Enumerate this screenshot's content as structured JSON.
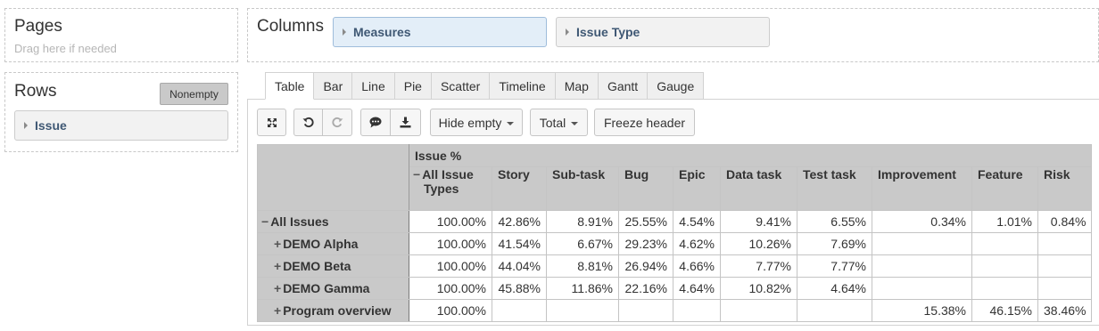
{
  "pages_panel": {
    "title": "Pages",
    "hint": "Drag here if needed"
  },
  "rows_panel": {
    "title": "Rows",
    "nonempty_label": "Nonempty",
    "chip_label": "Issue"
  },
  "columns_panel": {
    "title": "Columns",
    "chips": [
      "Measures",
      "Issue Type"
    ]
  },
  "tabs": [
    "Table",
    "Bar",
    "Line",
    "Pie",
    "Scatter",
    "Timeline",
    "Map",
    "Gantt",
    "Gauge"
  ],
  "active_tab": "Table",
  "toolbar": {
    "hide_empty_label": "Hide empty",
    "total_label": "Total",
    "freeze_label": "Freeze header"
  },
  "table": {
    "measure_header": "Issue %",
    "all_types_header_1": "All Issue",
    "all_types_header_2": "Types",
    "columns": [
      "Story",
      "Sub-task",
      "Bug",
      "Epic",
      "Data task",
      "Test task",
      "Improvement",
      "Feature",
      "Risk"
    ],
    "rows": [
      {
        "sign": "−",
        "label": "All Issues",
        "indent": 0,
        "values": [
          "100.00%",
          "42.86%",
          "8.91%",
          "25.55%",
          "4.54%",
          "9.41%",
          "6.55%",
          "0.34%",
          "1.01%",
          "0.84%"
        ]
      },
      {
        "sign": "+",
        "label": "DEMO Alpha",
        "indent": 1,
        "values": [
          "100.00%",
          "41.54%",
          "6.67%",
          "29.23%",
          "4.62%",
          "10.26%",
          "7.69%",
          "",
          "",
          ""
        ]
      },
      {
        "sign": "+",
        "label": "DEMO Beta",
        "indent": 1,
        "values": [
          "100.00%",
          "44.04%",
          "8.81%",
          "26.94%",
          "4.66%",
          "7.77%",
          "7.77%",
          "",
          "",
          ""
        ]
      },
      {
        "sign": "+",
        "label": "DEMO Gamma",
        "indent": 1,
        "values": [
          "100.00%",
          "45.88%",
          "11.86%",
          "22.16%",
          "4.64%",
          "10.82%",
          "4.64%",
          "",
          "",
          ""
        ]
      },
      {
        "sign": "+",
        "label": "Program overview",
        "indent": 1,
        "values": [
          "100.00%",
          "",
          "",
          "",
          "",
          "",
          "",
          "15.38%",
          "46.15%",
          "38.46%"
        ]
      }
    ]
  }
}
